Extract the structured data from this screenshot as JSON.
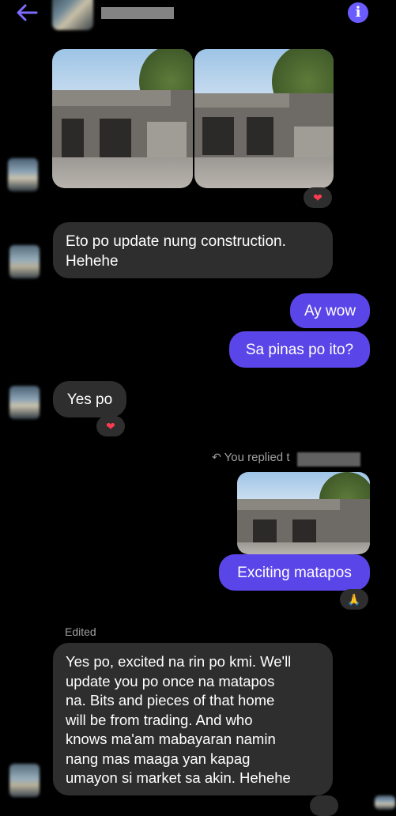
{
  "header": {
    "back_icon": "arrow-left-icon",
    "info_icon": "info-icon",
    "info_label": "i",
    "accent": "#6b5cff"
  },
  "messages": {
    "m1_line1": "Eto po update nung construction.",
    "m1_line2": "Hehehe",
    "m2": "Ay wow",
    "m3": "Sa pinas po ito?",
    "m4": "Yes po",
    "reply_label": "You replied t",
    "m5": "Exciting matapos",
    "edited_label": "Edited",
    "m6_lines": [
      "Yes po, excited na rin po kmi. We'll",
      "update you po once na matapos",
      "na. Bits and pieces of that home",
      "will be from trading. And who",
      "knows ma'am mabayaran namin",
      "nang mas maaga yan kapag",
      "umayon si market sa akin. Hehehe"
    ]
  },
  "reactions": {
    "heart": "❤",
    "pray": "🙏"
  },
  "colors": {
    "sent_bubble": "#5a45e8",
    "received_bubble": "#2e2e2e",
    "background": "#000000"
  }
}
